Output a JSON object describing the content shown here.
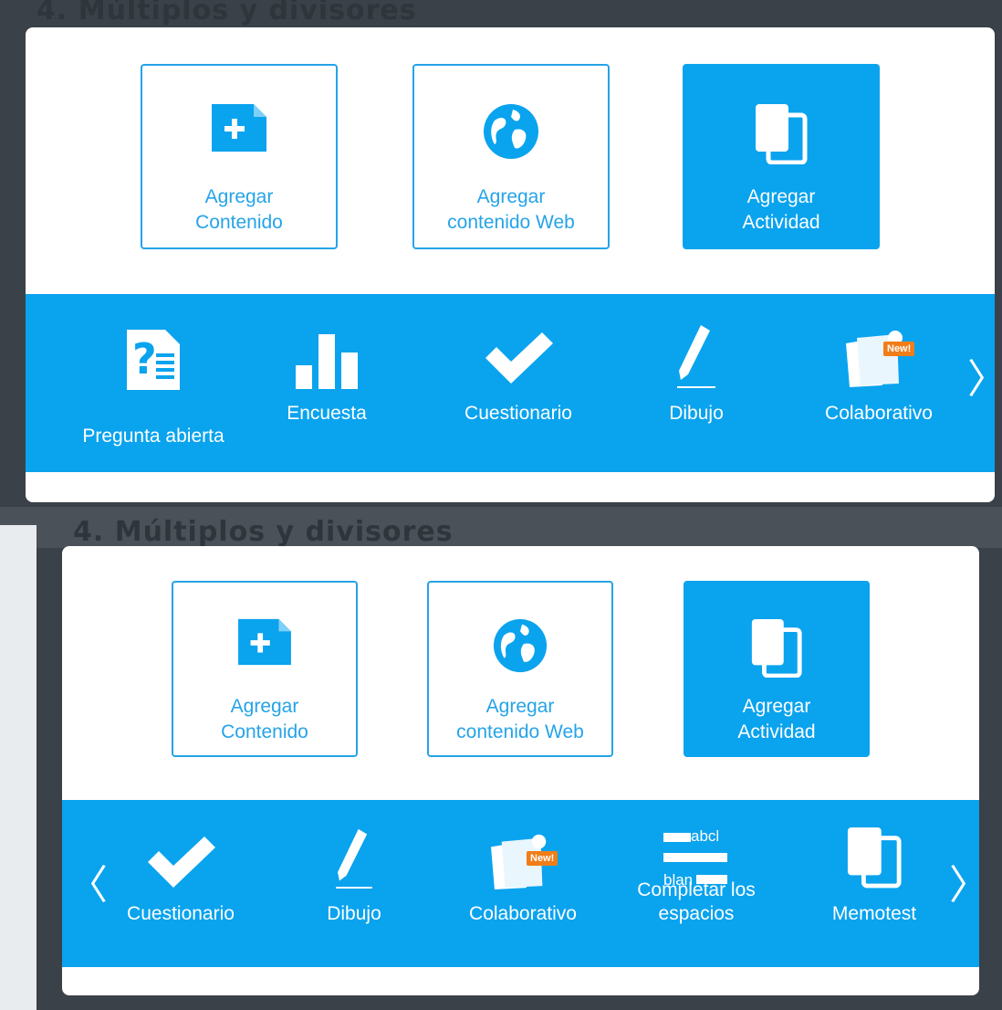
{
  "background": {
    "heading_text": "4. Múltiplos y divisores"
  },
  "panel_top": {
    "tiles": [
      {
        "label": "Agregar Contenido",
        "icon": "add-folder-icon"
      },
      {
        "label": "Agregar contenido Web",
        "icon": "globe-icon"
      },
      {
        "label": "Agregar Actividad",
        "icon": "copy-cards-icon"
      }
    ],
    "activities": [
      {
        "label": "Pregunta abierta",
        "icon": "open-question-icon"
      },
      {
        "label": "Encuesta",
        "icon": "bar-chart-icon"
      },
      {
        "label": "Cuestionario",
        "icon": "checkmark-icon"
      },
      {
        "label": "Dibujo",
        "icon": "pencil-icon"
      },
      {
        "label": "Colaborativo",
        "icon": "collaborative-icon",
        "badge": "New!"
      }
    ],
    "next_arrow": "〉"
  },
  "panel_bottom": {
    "tiles": [
      {
        "label": "Agregar Contenido",
        "icon": "add-folder-icon"
      },
      {
        "label": "Agregar contenido Web",
        "icon": "globe-icon"
      },
      {
        "label": "Agregar Actividad",
        "icon": "copy-cards-icon"
      }
    ],
    "activities": [
      {
        "label": "Cuestionario",
        "icon": "checkmark-icon"
      },
      {
        "label": "Dibujo",
        "icon": "pencil-icon"
      },
      {
        "label": "Colaborativo",
        "icon": "collaborative-icon",
        "badge": "New!"
      },
      {
        "label": "Completar los espacios",
        "icon": "fill-blanks-icon",
        "icon_text_1": "abcl",
        "icon_text_2": "blan"
      },
      {
        "label": "Memotest",
        "icon": "memotest-icon"
      }
    ],
    "prev_arrow": "〈",
    "next_arrow": "〉"
  },
  "colors": {
    "accent": "#0aa3ee",
    "badge": "#f07d18",
    "panel": "#ffffff",
    "backdrop": "#3a4148"
  }
}
